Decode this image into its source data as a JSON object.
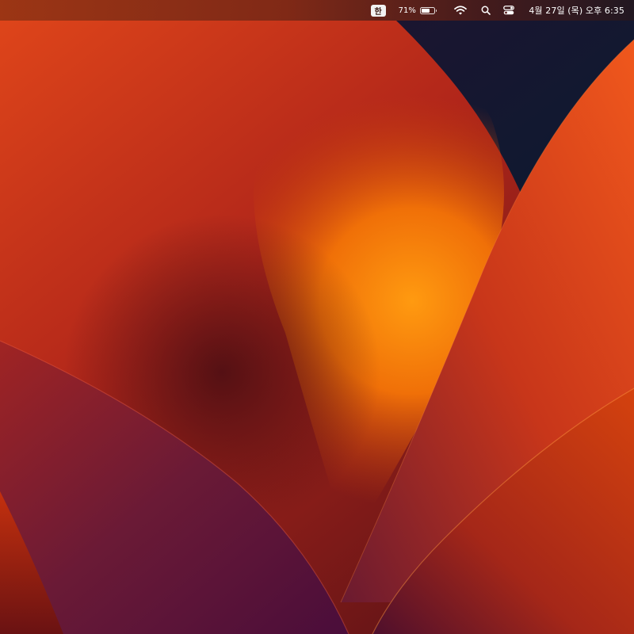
{
  "menubar": {
    "input_source": "한",
    "battery": {
      "percent_label": "71%",
      "level": 0.71
    },
    "icons": [
      "wifi-icon",
      "search-icon",
      "control-center-icon",
      "battery-icon"
    ],
    "clock": "4월 27일 (목) 오후 6:35"
  },
  "wallpaper": {
    "name": "macOS Ventura",
    "colors": {
      "deep_navy": "#0f1a33",
      "dark_maroon": "#3a0d18",
      "crimson": "#a82014",
      "orange_red": "#e14a14",
      "bright_orange": "#ff8a00",
      "magenta_purple": "#6e1a45"
    }
  }
}
